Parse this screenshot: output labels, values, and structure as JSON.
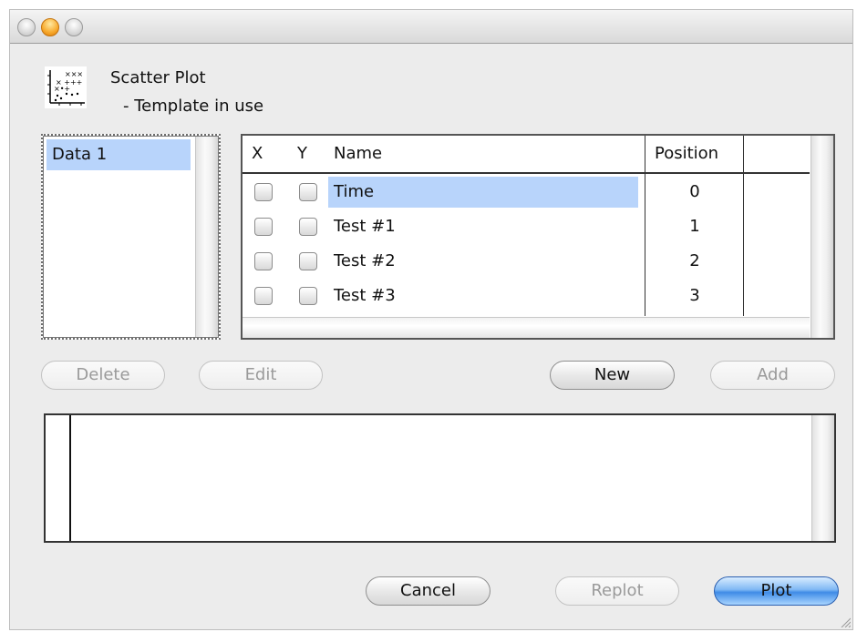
{
  "window": {
    "title": "",
    "controls": [
      "close",
      "minimize",
      "zoom"
    ]
  },
  "header": {
    "icon": "scatter-plot-icon",
    "title": "Scatter Plot",
    "subtitle": "- Template in use"
  },
  "data_list": {
    "items": [
      {
        "label": "Data 1",
        "selected": true
      }
    ]
  },
  "variables_table": {
    "columns": [
      "X",
      "Y",
      "Name",
      "Position"
    ],
    "rows": [
      {
        "x": false,
        "y": false,
        "name": "Time",
        "position": "0",
        "selected": true
      },
      {
        "x": false,
        "y": false,
        "name": "Test #1",
        "position": "1",
        "selected": false
      },
      {
        "x": false,
        "y": false,
        "name": "Test #2",
        "position": "2",
        "selected": false
      },
      {
        "x": false,
        "y": false,
        "name": "Test #3",
        "position": "3",
        "selected": false
      }
    ]
  },
  "buttons": {
    "delete": "Delete",
    "edit": "Edit",
    "new": "New",
    "add": "Add",
    "cancel": "Cancel",
    "replot": "Replot",
    "plot": "Plot"
  },
  "colors": {
    "selection": "#b8d4fb",
    "primary_button": "#3f8be6"
  }
}
